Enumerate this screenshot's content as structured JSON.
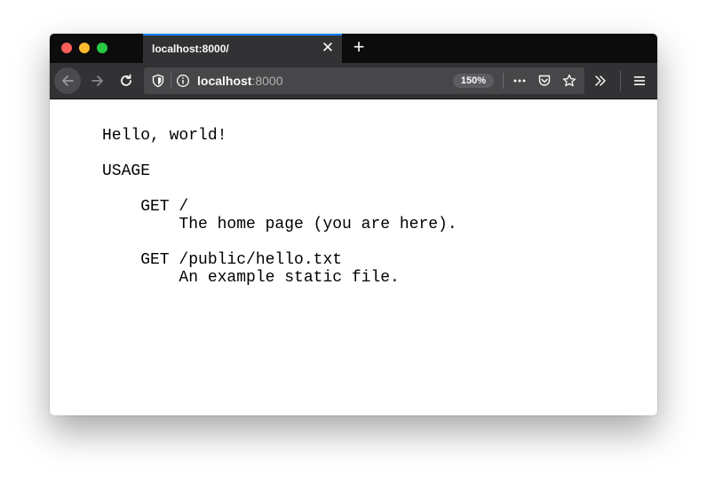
{
  "browser": {
    "tab": {
      "title": "localhost:8000/"
    },
    "address_bar": {
      "host": "localhost",
      "port": ":8000",
      "zoom": "150%"
    }
  },
  "page": {
    "lines": [
      "Hello, world!",
      "",
      "USAGE",
      "",
      "    GET /",
      "        The home page (you are here).",
      "",
      "    GET /public/hello.txt",
      "        An example static file."
    ]
  },
  "colors": {
    "tab_accent": "#0a84ff",
    "titlebar": "#0c0c0d",
    "toolbar": "#323234"
  }
}
